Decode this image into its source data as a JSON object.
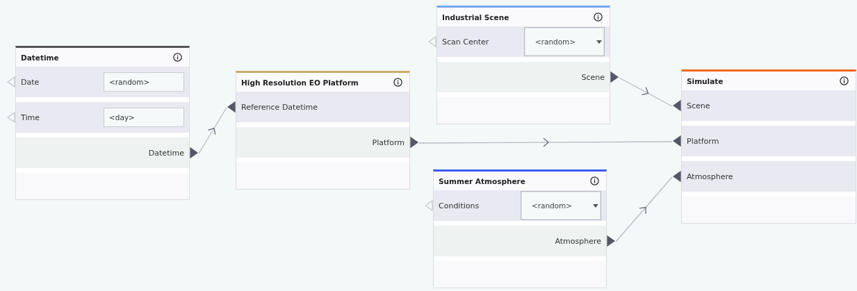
{
  "nodes": [
    {
      "title": "Datetime",
      "color": "#555555",
      "rows": [
        {
          "kind": "input",
          "label": "Date",
          "connected": false,
          "field": {
            "kind": "text",
            "value": "<random>"
          }
        },
        {
          "kind": "input",
          "label": "Time",
          "connected": false,
          "field": {
            "kind": "text",
            "value": "<day>"
          }
        },
        {
          "kind": "output",
          "label": "Datetime",
          "connected": true
        }
      ]
    },
    {
      "title": "High Resolution EO Platform",
      "color": "#c9ab6b",
      "rows": [
        {
          "kind": "input",
          "label": "Reference Datetime",
          "connected": true
        },
        {
          "kind": "output",
          "label": "Platform",
          "connected": true
        }
      ]
    },
    {
      "title": "Industrial Scene",
      "color": "#72a8ea",
      "rows": [
        {
          "kind": "input",
          "label": "Scan Center",
          "connected": false,
          "field": {
            "kind": "dropdown",
            "value": "<random>"
          }
        },
        {
          "kind": "output",
          "label": "Scene",
          "connected": true
        }
      ]
    },
    {
      "title": "Summer Atmosphere",
      "color": "#3b5cf0",
      "rows": [
        {
          "kind": "input",
          "label": "Conditions",
          "connected": false,
          "field": {
            "kind": "dropdown",
            "value": "<random>"
          }
        },
        {
          "kind": "output",
          "label": "Atmosphere",
          "connected": true
        }
      ]
    },
    {
      "title": "Simulate",
      "color": "#f26a1b",
      "rows": [
        {
          "kind": "input",
          "label": "Scene",
          "connected": true
        },
        {
          "kind": "input",
          "label": "Platform",
          "connected": true
        },
        {
          "kind": "input",
          "label": "Atmosphere",
          "connected": true
        }
      ]
    }
  ]
}
